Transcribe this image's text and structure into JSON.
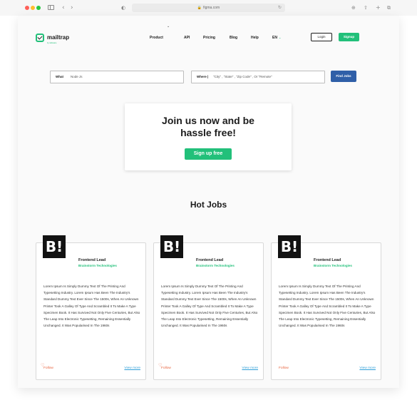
{
  "browser": {
    "url": "figma.com",
    "icons": [
      "sidebar-icon",
      "back-icon",
      "forward-icon",
      "shield-icon",
      "lock-icon",
      "reload-icon",
      "download-icon",
      "share-icon",
      "new-tab-icon",
      "tabs-icon"
    ]
  },
  "header": {
    "logo_text": "mailtrap",
    "logo_subtext": "by railsware",
    "nav": [
      {
        "label": "Product"
      },
      {
        "label": "API"
      },
      {
        "label": "Pricing"
      },
      {
        "label": "Blog"
      },
      {
        "label": "Help"
      },
      {
        "label": "EN"
      }
    ],
    "login_label": "Login",
    "signup_label": "Signup"
  },
  "search": {
    "what_label": "What",
    "what_value": "Node Js",
    "where_label": "Where |",
    "where_placeholder": "\"City\" , \"State\" , \"Zip Code\" , Or \"Remote\"",
    "button_label": "Find Jobs"
  },
  "join": {
    "title": "Join us now and be hassle free!",
    "button_label": "Sign up free"
  },
  "jobs_heading": "Hot Jobs",
  "jobs": [
    {
      "logo": "B!",
      "title": "Frontend Lead",
      "company": "Brainstorm Technologies",
      "description": "Lorem Ipsum Is Simply Dummy Text Of The Printing And Typesetting Industry. Lorem Ipsum Has Been The Industry's Standard Dummy Text Ever Since The 1500s, When An Unknown Printer Took A Galley Of Type And Scrambled It To Make A Type Specimen Book. It Has Survived Not Only Five Centuries, But Also The Leap Into Electronic Typesetting, Remaining Essentially Unchanged. It Was Popularised In The 1960s",
      "follow_label": "Follow",
      "view_more_label": "View more"
    },
    {
      "logo": "B!",
      "title": "Frontend Lead",
      "company": "Brainstorm Technologies",
      "description": "Lorem Ipsum Is Simply Dummy Text Of The Printing And Typesetting Industry. Lorem Ipsum Has Been The Industry's Standard Dummy Text Ever Since The 1500s, When An Unknown Printer Took A Galley Of Type And Scrambled It To Make A Type Specimen Book. It Has Survived Not Only Five Centuries, But Also The Leap Into Electronic Typesetting, Remaining Essentially Unchanged. It Was Popularised In The 1960s",
      "follow_label": "Follow",
      "view_more_label": "View more"
    },
    {
      "logo": "B!",
      "title": "Frontend Lead",
      "company": "Brainstorm Technologies",
      "description": "Lorem Ipsum Is Simply Dummy Text Of The Printing And Typesetting Industry. Lorem Ipsum Has Been The Industry's Standard Dummy Text Ever Since The 1500s, When An Unknown Printer Took A Galley Of Type And Scrambled It To Make A Type Specimen Book. It Has Survived Not Only Five Centuries, But Also The Leap Into Electronic Typesetting, Remaining Essentially Unchanged. It Was Popularised In The 1960s",
      "follow_label": "Follow",
      "view_more_label": "View more"
    }
  ],
  "colors": {
    "accent_green": "#22c07a",
    "button_blue": "#2f5fa8",
    "follow_orange": "#e8623c",
    "link_blue": "#2f9fd8"
  }
}
